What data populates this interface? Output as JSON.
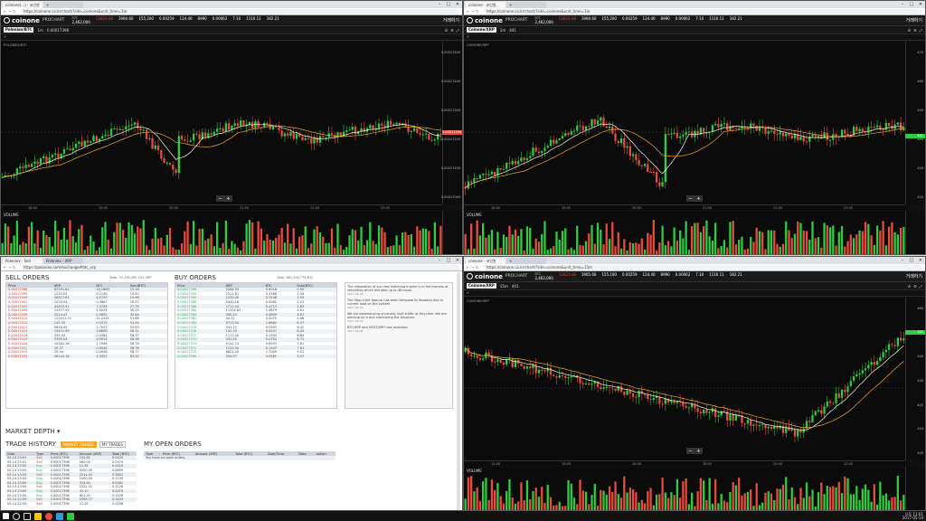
{
  "colors": {
    "up": "#2ecc40",
    "down": "#e74c3c",
    "bg": "#0b0b0b",
    "accent": "#f5a623",
    "price_tag": "#e74c3c"
  },
  "topleft": {
    "tabs": [
      {
        "label": "coinone(…) · 코인원"
      },
      {
        "label": ""
      }
    ],
    "url": "https://coinone.co.kr/chart/?site=coinone&unit_time=1m",
    "brand": "coinone",
    "product": "PROCHART",
    "stats": [
      {
        "label": "BTC",
        "value": "2,462,000"
      },
      {
        "label": "",
        "value": "12623.48",
        "red": true
      },
      {
        "label": "",
        "value": "1960.60"
      },
      {
        "label": "",
        "value": "155,200"
      },
      {
        "label": "",
        "value": "0.00259"
      },
      {
        "label": "",
        "value": "124.40"
      },
      {
        "label": "",
        "value": "8990"
      },
      {
        "label": "",
        "value": "0.00062"
      },
      {
        "label": "",
        "value": "7.10"
      },
      {
        "label": "",
        "value": "1116.11"
      },
      {
        "label": "",
        "value": "182.21"
      }
    ],
    "korean": "거래하기",
    "pair": "Poloniex/BTC",
    "timeframe": "1m",
    "price": "0.00017396",
    "chart_title": "POLONIEX/BTC",
    "volume_label": "VOLUME",
    "axis_ticks": [
      "0.00017500",
      "0.00017400",
      "0.00017300",
      "0.00017200",
      "0.00017100",
      "0.00017000"
    ],
    "price_tag": "0.00017396",
    "x_ticks": [
      "18:00",
      "19:00",
      "20:00",
      "21:00",
      "22:00",
      "23:00"
    ]
  },
  "topright": {
    "tabs": [
      {
        "label": "coinone · 코인원"
      }
    ],
    "url": "https://coinone.co.kr/chart/?site=coinone&unit_time=1m",
    "brand": "coinone",
    "product": "PROCHART",
    "stats": [
      {
        "label": "BTC",
        "value": "2,462,000"
      },
      {
        "label": "",
        "value": "12623.48",
        "red": true
      },
      {
        "label": "",
        "value": "1960.60"
      },
      {
        "label": "",
        "value": "155,200"
      },
      {
        "label": "",
        "value": "0.00259"
      },
      {
        "label": "",
        "value": "124.40"
      },
      {
        "label": "",
        "value": "8990"
      },
      {
        "label": "",
        "value": "0.00062"
      },
      {
        "label": "",
        "value": "7.10"
      },
      {
        "label": "",
        "value": "1116.11"
      },
      {
        "label": "",
        "value": "182.21"
      }
    ],
    "korean": "거래하기",
    "pair": "Coinone/XRP",
    "timeframe": "1m",
    "price": "441",
    "chart_title": "COINONE/XRP",
    "volume_label": "VOLUME",
    "axis_ticks": [
      "470",
      "460",
      "450",
      "440",
      "430",
      "420"
    ],
    "price_tag": "441",
    "x_ticks": [
      "18:00",
      "19:00",
      "20:00",
      "21:00",
      "22:00",
      "23:00"
    ]
  },
  "bottomleft": {
    "tabs": [
      {
        "label": "Poloniex · Sell"
      },
      {
        "label": "Poloniex · XRP"
      }
    ],
    "url": "https://poloniex.com/exchange#btc_xrp",
    "sell_title": "SELL ORDERS",
    "sell_total": "Total: 37,236,495,243 XRP",
    "buy_title": "BUY ORDERS",
    "buy_total": "Total: 681,500,776 BTC",
    "order_headers": [
      "Price",
      "XRP",
      "BTC",
      "Sum(BTC)"
    ],
    "sell_rows": [
      [
        "0.00017398",
        "87291.61",
        "15.1869",
        "15.18"
      ],
      [
        "0.00017399",
        "1234.55",
        "0.2148",
        "15.40"
      ],
      [
        "0.00017400",
        "26317.81",
        "4.5793",
        "19.98"
      ],
      [
        "0.00017401",
        "2233.94",
        "0.3887",
        "20.37"
      ],
      [
        "0.00017403",
        "42403.51",
        "7.3795",
        "27.75"
      ],
      [
        "0.00017405",
        "14377.55",
        "2.5024",
        "30.25"
      ],
      [
        "0.00017409",
        "2214.47",
        "0.3855",
        "30.64"
      ],
      [
        "0.00017410",
        "122011.15",
        "21.2421",
        "51.88"
      ],
      [
        "0.00017412",
        "215.35",
        "0.0375",
        "51.92"
      ],
      [
        "0.00017413",
        "9816.40",
        "1.7093",
        "53.63"
      ],
      [
        "0.00017415",
        "15421.99",
        "2.6858",
        "56.31"
      ],
      [
        "0.00017418",
        "335.44",
        "0.0584",
        "56.37"
      ],
      [
        "0.00017419",
        "3395.09",
        "0.5914",
        "56.96"
      ],
      [
        "0.00017420",
        "10302.16",
        "1.7946",
        "58.76"
      ],
      [
        "0.00017421",
        "25.37",
        "0.0044",
        "58.76"
      ],
      [
        "0.00017423",
        "33.54",
        "0.0058",
        "58.77"
      ],
      [
        "0.00017425",
        "26142.16",
        "4.5553",
        "63.32"
      ]
    ],
    "buy_rows": [
      [
        "0.00017396",
        "5184.33",
        "0.9018",
        "0.90"
      ],
      [
        "0.00017395",
        "2511.61",
        "0.4368",
        "1.34"
      ],
      [
        "0.00017390",
        "1234.00",
        "0.2146",
        "1.55"
      ],
      [
        "0.00017389",
        "3440.18",
        "0.5982",
        "2.15"
      ],
      [
        "0.00017388",
        "2711.04",
        "0.4713",
        "2.62"
      ],
      [
        "0.00017385",
        "11434.82",
        "1.9879",
        "4.61"
      ],
      [
        "0.00017384",
        "350.23",
        "0.0609",
        "4.67"
      ],
      [
        "0.00017382",
        "43.22",
        "0.0075",
        "4.68"
      ],
      [
        "0.00017380",
        "9713.50",
        "1.6882",
        "6.37"
      ],
      [
        "0.00017379",
        "341.12",
        "0.0593",
        "6.42"
      ],
      [
        "0.00017378",
        "142.33",
        "0.0247",
        "6.45"
      ],
      [
        "0.00017377",
        "1113.00",
        "0.1934",
        "6.64"
      ],
      [
        "0.00017375",
        "432.55",
        "0.0752",
        "6.72"
      ],
      [
        "0.00017374",
        "5141.74",
        "0.8933",
        "7.61"
      ],
      [
        "0.00017371",
        "1121.00",
        "0.1947",
        "7.81"
      ],
      [
        "0.00017370",
        "9821.00",
        "1.7059",
        "9.51"
      ],
      [
        "0.00017369",
        "334.57",
        "0.0581",
        "9.57"
      ]
    ],
    "news": [
      {
        "text": "The integration of our new matching engine is in the process of rebuilding which will take up to 48 hours.",
        "time": "2017-05-14"
      },
      {
        "text": "The Stop-Limit feature has been temporarily disabled due to current load on the system.",
        "time": "2017-05-12"
      },
      {
        "text": "We are experiencing unusually high traffic at this time. We are working on it and monitoring the situation.",
        "time": "2017-05-10"
      },
      {
        "text": "BTC/XRP and USDT/XRP now available.",
        "time": "2017-05-08"
      }
    ],
    "market_depth": "MARKET DEPTH",
    "trade_history": "TRADE HISTORY",
    "trade_tabs": [
      "MARKET TRADES",
      "MY TRADES"
    ],
    "trade_headers": [
      "Date",
      "Type",
      "Price (BTC)",
      "Amount (XRP)",
      "Total (BTC)"
    ],
    "trade_rows": [
      [
        "05-14 23:01",
        "Sell",
        "0.00017396",
        "241.62",
        "0.0420"
      ],
      [
        "05-14 23:01",
        "Sell",
        "0.00017396",
        "560.00",
        "0.0974"
      ],
      [
        "05-14 23:00",
        "Buy",
        "0.00017398",
        "11.35",
        "0.0019"
      ],
      [
        "05-14 23:00",
        "Buy",
        "0.00017398",
        "5000.00",
        "0.8699"
      ],
      [
        "05-14 23:00",
        "Sell",
        "0.00017396",
        "2214.43",
        "0.3852"
      ],
      [
        "05-14 23:00",
        "Buy",
        "0.00017398",
        "1000.00",
        "0.1739"
      ],
      [
        "05-14 23:00",
        "Buy",
        "0.00017398",
        "334.64",
        "0.0582"
      ],
      [
        "05-14 23:00",
        "Sell",
        "0.00017396",
        "1222.32",
        "0.2126"
      ],
      [
        "05-14 23:00",
        "Buy",
        "0.00017398",
        "43.10",
        "0.0074"
      ],
      [
        "05-14 23:00",
        "Buy",
        "0.00017398",
        "821.33",
        "0.1428"
      ],
      [
        "05-14 22:59",
        "Sell",
        "0.00017396",
        "1956.37",
        "0.3403"
      ],
      [
        "05-14 22:59",
        "Sell",
        "0.00017396",
        "21.05",
        "0.0036"
      ]
    ],
    "open_orders_title": "MY OPEN ORDERS",
    "open_headers": [
      "Type",
      "Price (BTC)",
      "Amount (XRP)",
      "Total (BTC)",
      "Date/Time",
      "Date",
      "Action"
    ],
    "open_empty": "You have no open orders."
  },
  "bottomright": {
    "tabs": [
      {
        "label": "coinone · 코인원"
      }
    ],
    "url": "https://coinone.co.kr/chart/?site=coinone&unit_time=15m",
    "brand": "coinone",
    "product": "PROCHART",
    "stats": [
      {
        "label": "BTC",
        "value": "2,462,000"
      },
      {
        "label": "",
        "value": "12623.48",
        "red": true
      },
      {
        "label": "",
        "value": "1965.60"
      },
      {
        "label": "",
        "value": "155,100"
      },
      {
        "label": "",
        "value": "0.00259"
      },
      {
        "label": "",
        "value": "124.40"
      },
      {
        "label": "",
        "value": "8990"
      },
      {
        "label": "",
        "value": "0.00062"
      },
      {
        "label": "",
        "value": "7.10"
      },
      {
        "label": "",
        "value": "1116.11"
      },
      {
        "label": "",
        "value": "182.21"
      }
    ],
    "korean": "거래하기",
    "pair": "Coinone/XRP",
    "timeframe": "15m",
    "price": "441",
    "chart_title": "COINONE/XRP",
    "volume_label": "VOLUME",
    "axis_ticks": [
      "460",
      "450",
      "440",
      "430",
      "420",
      "410",
      "400"
    ],
    "price_tag": "441",
    "x_ticks": [
      "12:00",
      "14:00",
      "16:00",
      "18:00",
      "20:00",
      "22:00"
    ]
  },
  "taskbar": {
    "time": "오후 11:01",
    "date": "2017-05-14"
  }
}
